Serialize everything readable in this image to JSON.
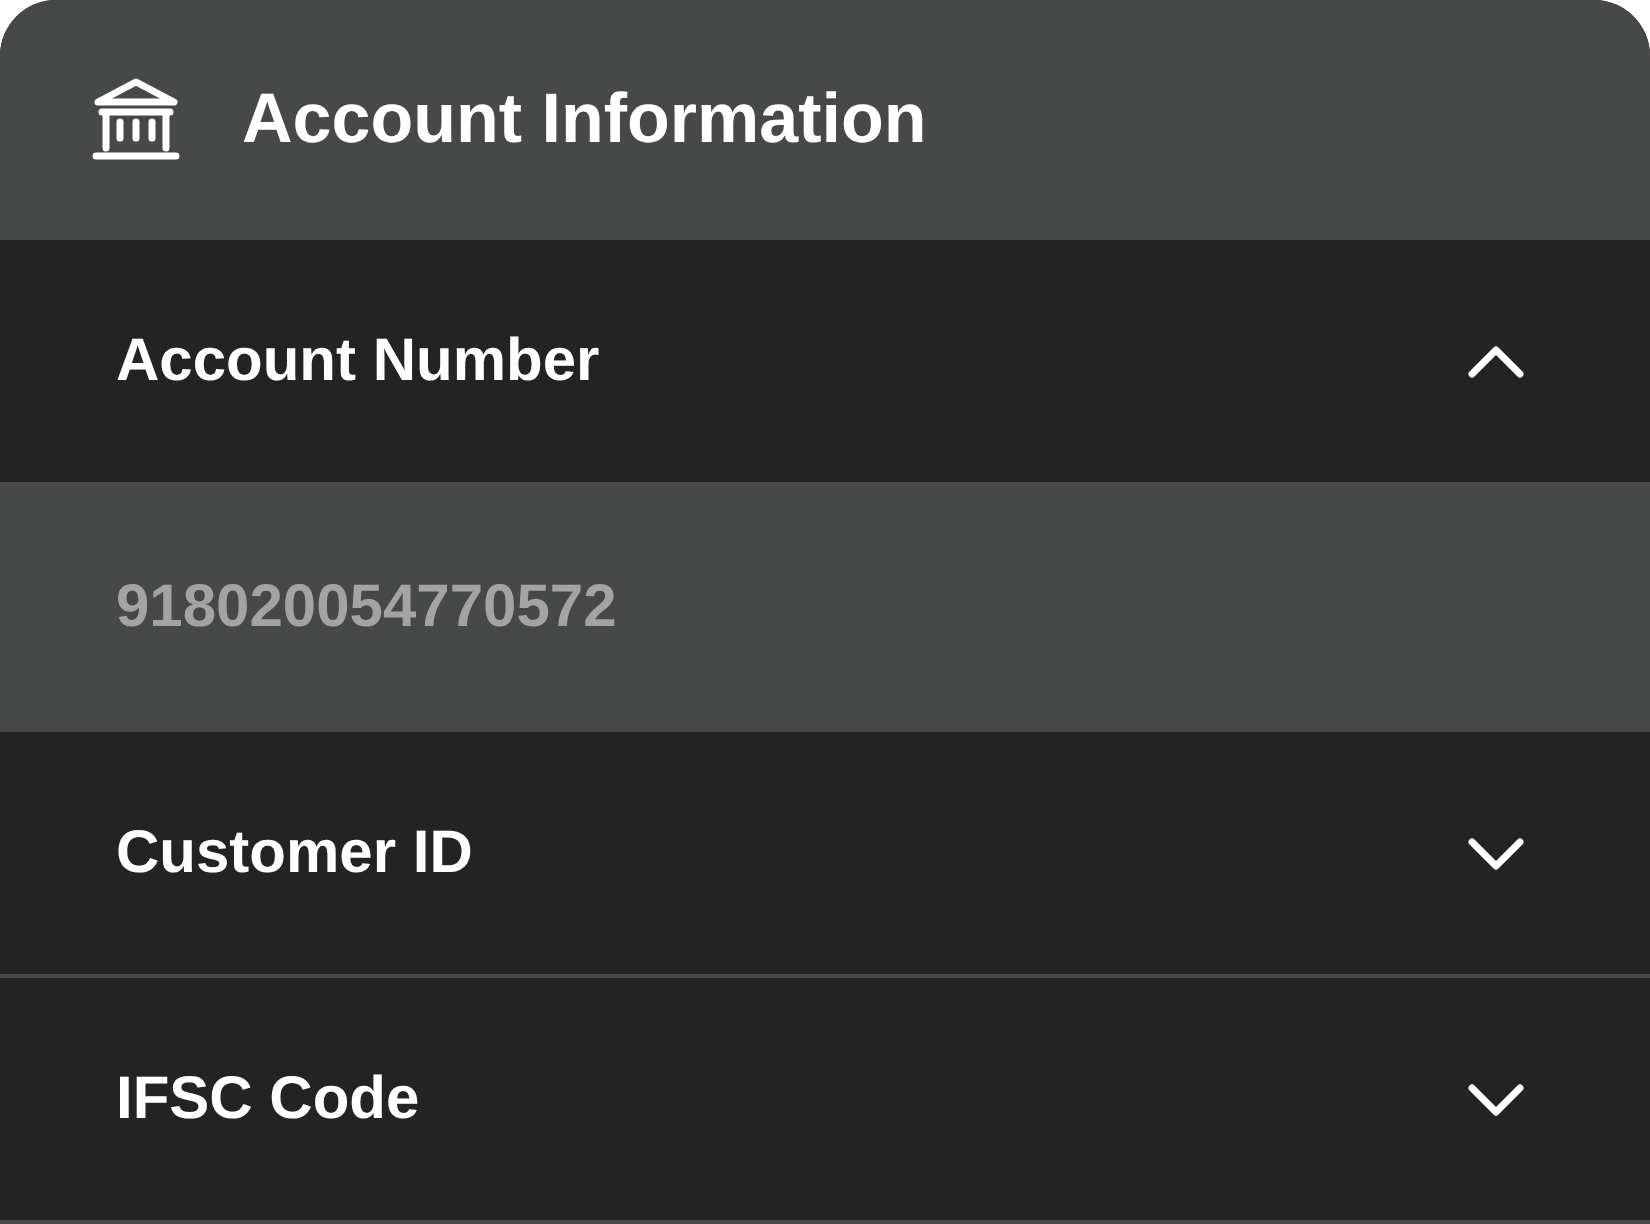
{
  "title": "Account Information",
  "sections": [
    {
      "label": "Account Number",
      "expanded": true,
      "value": "918020054770572"
    },
    {
      "label": "Customer ID",
      "expanded": false
    },
    {
      "label": "IFSC Code",
      "expanded": false
    }
  ]
}
